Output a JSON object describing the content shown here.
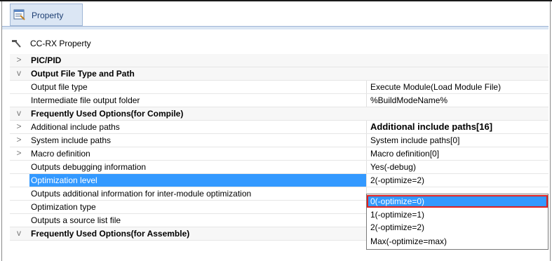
{
  "window": {
    "tab_label": "Property"
  },
  "header": {
    "label": "CC-RX Property"
  },
  "rows": [
    {
      "type": "category",
      "expander": ">",
      "name": "PIC/PID",
      "value": ""
    },
    {
      "type": "category",
      "expander": "v",
      "name": "Output File Type and Path",
      "value": ""
    },
    {
      "type": "property",
      "expander": "",
      "name": "Output file type",
      "value": "Execute Module(Load Module File)"
    },
    {
      "type": "property",
      "expander": "",
      "name": "Intermediate file output folder",
      "value": "%BuildModeName%"
    },
    {
      "type": "category",
      "expander": "v",
      "name": "Frequently Used Options(for Compile)",
      "value": ""
    },
    {
      "type": "property",
      "expander": ">",
      "name": "Additional include paths",
      "value": "Additional include paths[16]"
    },
    {
      "type": "property",
      "expander": ">",
      "name": "System include paths",
      "value": "System include paths[0]"
    },
    {
      "type": "property",
      "expander": ">",
      "name": "Macro definition",
      "value": "Macro definition[0]"
    },
    {
      "type": "property",
      "expander": "",
      "name": "Outputs debugging information",
      "value": "Yes(-debug)"
    },
    {
      "type": "property",
      "expander": "",
      "name": "Optimization level",
      "value": "2(-optimize=2)"
    },
    {
      "type": "property",
      "expander": "",
      "name": "Outputs additional information for inter-module optimization",
      "value": ""
    },
    {
      "type": "property",
      "expander": "",
      "name": "Optimization type",
      "value": ""
    },
    {
      "type": "property",
      "expander": "",
      "name": "Outputs a source list file",
      "value": ""
    },
    {
      "type": "category",
      "expander": "v",
      "name": "Frequently Used Options(for Assemble)",
      "value": ""
    }
  ],
  "dropdown": {
    "options": [
      "0(-optimize=0)",
      "1(-optimize=1)",
      "2(-optimize=2)",
      "Max(-optimize=max)"
    ],
    "highlighted_index": 0
  },
  "colors": {
    "selection": "#3399ff",
    "highlight_border": "#e02020",
    "tab_bg": "#dbe6f4"
  }
}
